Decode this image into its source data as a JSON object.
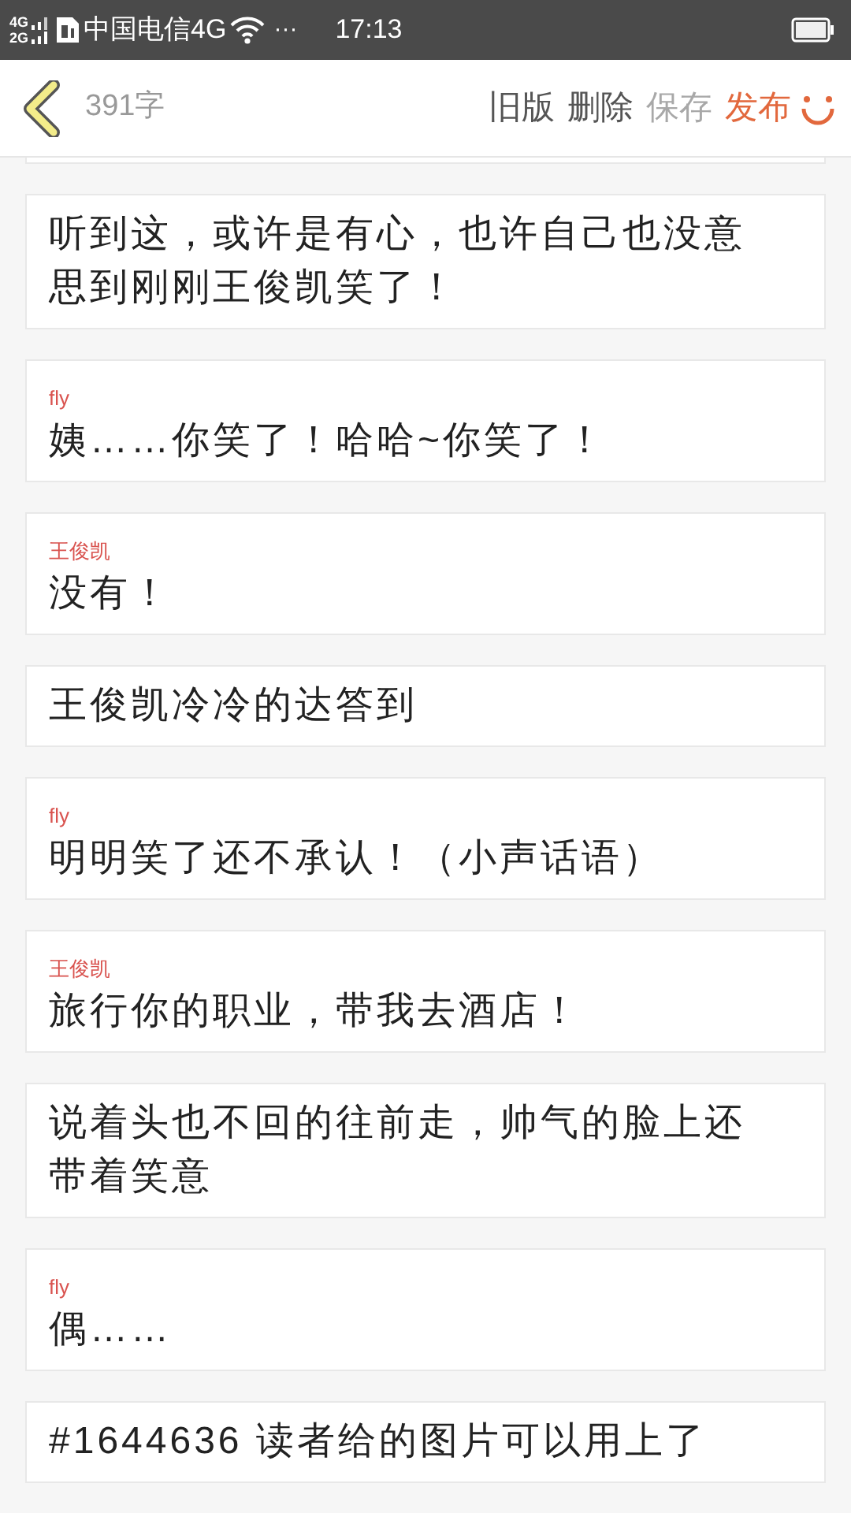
{
  "status_bar": {
    "network_top": "4G",
    "network_bottom": "2G",
    "carrier": "中国电信4G",
    "more": "···",
    "time": "17:13"
  },
  "header": {
    "word_count": "391字",
    "actions": [
      {
        "label": "旧版",
        "kind": "plain",
        "disabled": false
      },
      {
        "label": "删除",
        "kind": "plain",
        "disabled": false
      },
      {
        "label": "保存",
        "kind": "plain",
        "disabled": true
      },
      {
        "label": "发布",
        "kind": "primary",
        "disabled": false
      }
    ]
  },
  "entries": [
    {
      "kind": "partial"
    },
    {
      "kind": "narration",
      "text": "听到这，或许是有心，也许自己也没意思到刚刚王俊凯笑了！"
    },
    {
      "kind": "dialogue",
      "speaker": "fly",
      "text": "姨……你笑了！哈哈~你笑了！"
    },
    {
      "kind": "dialogue",
      "speaker": "王俊凯",
      "text": "没有！"
    },
    {
      "kind": "narration",
      "text": "王俊凯冷冷的达答到"
    },
    {
      "kind": "dialogue",
      "speaker": "fly",
      "text": "明明笑了还不承认！（小声话语）"
    },
    {
      "kind": "dialogue",
      "speaker": "王俊凯",
      "text": "旅行你的职业，带我去酒店！"
    },
    {
      "kind": "narration",
      "text": "说着头也不回的往前走，帅气的脸上还带着笑意"
    },
    {
      "kind": "dialogue",
      "speaker": "fly",
      "text": "偶……"
    },
    {
      "kind": "narration",
      "text": "#1644636 读者给的图片可以用上了"
    }
  ]
}
